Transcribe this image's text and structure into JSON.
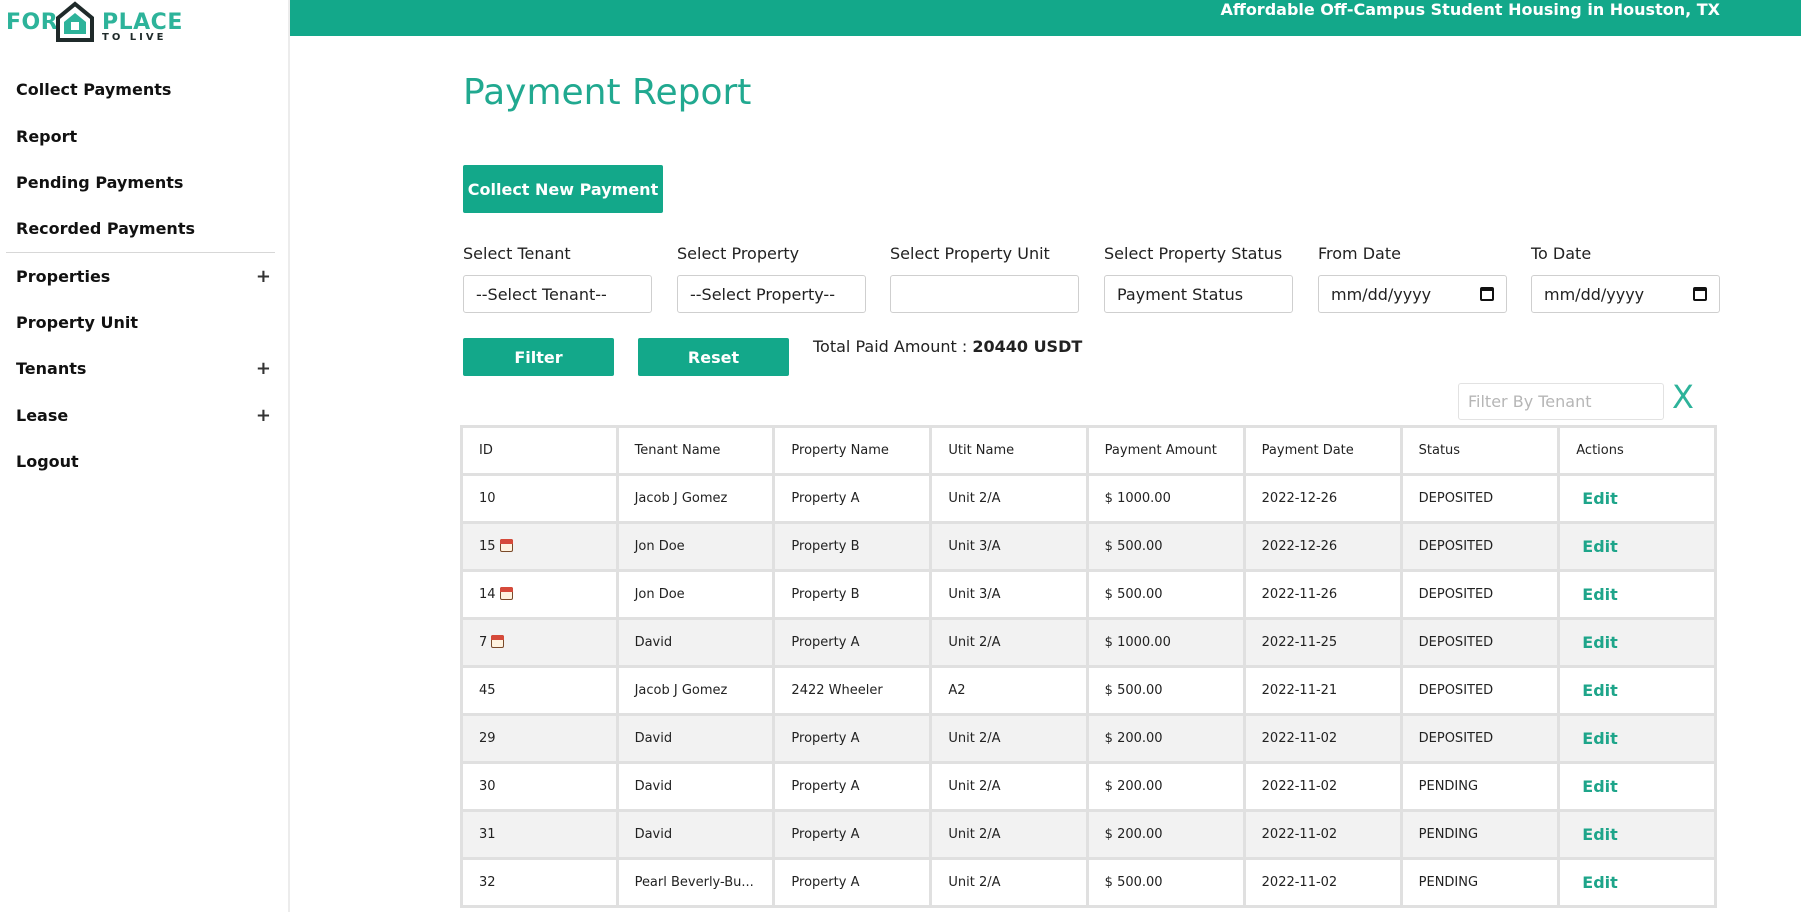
{
  "brand": {
    "logo_for": "FOR",
    "logo_place": "PLACE",
    "logo_tolive": "TO LIVE"
  },
  "header": {
    "tagline": "Affordable Off-Campus Student Housing in Houston, TX"
  },
  "sidebar": {
    "items": [
      {
        "label": "Collect Payments",
        "expandable": false
      },
      {
        "label": "Report",
        "expandable": false
      },
      {
        "label": "Pending Payments",
        "expandable": false
      },
      {
        "label": "Recorded Payments",
        "expandable": false
      },
      {
        "label": "Properties",
        "expandable": true
      },
      {
        "label": "Property Unit",
        "expandable": false
      },
      {
        "label": "Tenants",
        "expandable": true
      },
      {
        "label": "Lease",
        "expandable": true
      },
      {
        "label": "Logout",
        "expandable": false
      }
    ],
    "expand_symbol": "+"
  },
  "main": {
    "title": "Payment Report",
    "collect_button": "Collect New Payment",
    "filters": {
      "tenant_label": "Select Tenant",
      "tenant_value": "--Select Tenant--",
      "property_label": "Select Property",
      "property_value": "--Select Property--",
      "unit_label": "Select Property Unit",
      "unit_value": "",
      "status_label": "Select Property Status",
      "status_value": "Payment Status",
      "from_label": "From Date",
      "from_value": "mm/dd/yyyy",
      "to_label": "To Date",
      "to_value": "mm/dd/yyyy"
    },
    "filter_button": "Filter",
    "reset_button": "Reset",
    "total_label": "Total Paid Amount :",
    "total_value": "20440 USDT",
    "tenant_filter_placeholder": "Filter By Tenant",
    "clear_symbol": "X"
  },
  "table": {
    "headers": [
      "ID",
      "Tenant Name",
      "Property Name",
      "Utit Name",
      "Payment Amount",
      "Payment Date",
      "Status",
      "Actions"
    ],
    "action_label": "Edit",
    "rows": [
      {
        "id": "10",
        "note": false,
        "tenant": "Jacob J Gomez",
        "property": "Property A",
        "unit": "Unit 2/A",
        "amount": "$ 1000.00",
        "date": "2022-12-26",
        "status": "DEPOSITED"
      },
      {
        "id": "15",
        "note": true,
        "tenant": "Jon Doe",
        "property": "Property B",
        "unit": "Unit 3/A",
        "amount": "$ 500.00",
        "date": "2022-12-26",
        "status": "DEPOSITED"
      },
      {
        "id": "14",
        "note": true,
        "tenant": "Jon Doe",
        "property": "Property B",
        "unit": "Unit 3/A",
        "amount": "$ 500.00",
        "date": "2022-11-26",
        "status": "DEPOSITED"
      },
      {
        "id": "7",
        "note": true,
        "tenant": "David",
        "property": "Property A",
        "unit": "Unit 2/A",
        "amount": "$ 1000.00",
        "date": "2022-11-25",
        "status": "DEPOSITED"
      },
      {
        "id": "45",
        "note": false,
        "tenant": "Jacob J Gomez",
        "property": "2422 Wheeler",
        "unit": "A2",
        "amount": "$ 500.00",
        "date": "2022-11-21",
        "status": "DEPOSITED"
      },
      {
        "id": "29",
        "note": false,
        "tenant": "David",
        "property": "Property A",
        "unit": "Unit 2/A",
        "amount": "$ 200.00",
        "date": "2022-11-02",
        "status": "DEPOSITED"
      },
      {
        "id": "30",
        "note": false,
        "tenant": "David",
        "property": "Property A",
        "unit": "Unit 2/A",
        "amount": "$ 200.00",
        "date": "2022-11-02",
        "status": "PENDING"
      },
      {
        "id": "31",
        "note": false,
        "tenant": "David",
        "property": "Property A",
        "unit": "Unit 2/A",
        "amount": "$ 200.00",
        "date": "2022-11-02",
        "status": "PENDING"
      },
      {
        "id": "32",
        "note": false,
        "tenant": "Pearl Beverly-Bu...",
        "property": "Property A",
        "unit": "Unit 2/A",
        "amount": "$ 500.00",
        "date": "2022-11-02",
        "status": "PENDING"
      }
    ]
  },
  "colors": {
    "accent": "#13a88a",
    "title": "#21a990"
  }
}
